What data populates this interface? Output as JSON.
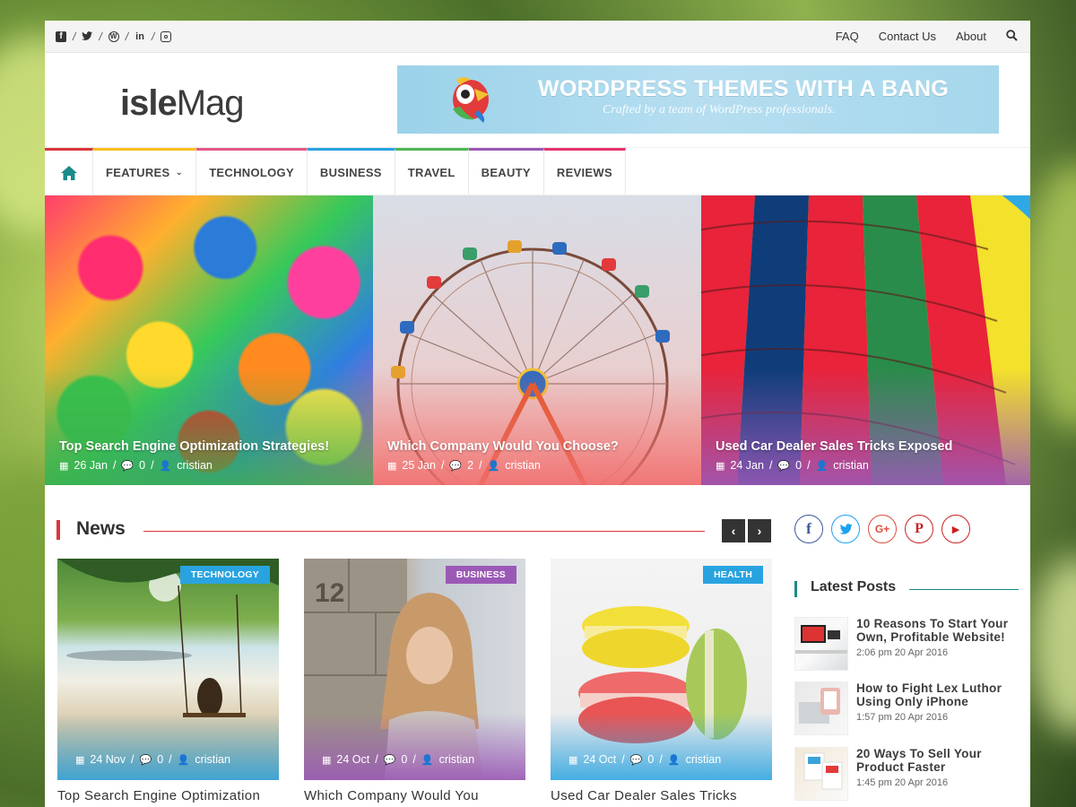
{
  "topbar": {
    "social_icons": [
      "facebook-icon",
      "twitter-icon",
      "wordpress-icon",
      "linkedin-icon",
      "instagram-icon"
    ],
    "links": [
      "FAQ",
      "Contact Us",
      "About"
    ]
  },
  "header": {
    "logo_bold": "isle",
    "logo_light": "Mag",
    "banner_title": "WORDPRESS THEMES WITH A BANG",
    "banner_subtitle": "Crafted by a team of WordPress professionals."
  },
  "nav": {
    "items": [
      {
        "label": "FEATURES",
        "dropdown": true,
        "color": "#f7c01f"
      },
      {
        "label": "TECHNOLOGY",
        "color": "#e35a87"
      },
      {
        "label": "BUSINESS",
        "color": "#29a3e0"
      },
      {
        "label": "TRAVEL",
        "color": "#52b556"
      },
      {
        "label": "BEAUTY",
        "color": "#9b59b6"
      },
      {
        "label": "REVIEWS",
        "color": "#e6336b"
      }
    ],
    "home_accent": "#d9363e"
  },
  "featured": [
    {
      "title": "Top Search Engine Optimization Strategies!",
      "date": "26 Jan",
      "comments": "0",
      "author": "cristian"
    },
    {
      "title": "Which Company Would You Choose?",
      "date": "25 Jan",
      "comments": "2",
      "author": "cristian"
    },
    {
      "title": "Used Car Dealer Sales Tricks Exposed",
      "date": "24 Jan",
      "comments": "0",
      "author": "cristian"
    }
  ],
  "news": {
    "heading": "News",
    "prev": "‹",
    "next": "›",
    "cards": [
      {
        "tag": "TECHNOLOGY",
        "tag_color": "#29a3e0",
        "date": "24 Nov",
        "comments": "0",
        "author": "cristian",
        "title": "Top Search Engine Optimization"
      },
      {
        "tag": "BUSINESS",
        "tag_color": "#9b59b6",
        "date": "24 Oct",
        "comments": "0",
        "author": "cristian",
        "title": "Which Company Would You"
      },
      {
        "tag": "HEALTH",
        "tag_color": "#29a3e0",
        "date": "24 Oct",
        "comments": "0",
        "author": "cristian",
        "title": "Used Car Dealer Sales Tricks"
      }
    ]
  },
  "sidebar": {
    "socials": [
      {
        "name": "facebook",
        "glyph": "f",
        "color": "#3b5998"
      },
      {
        "name": "twitter",
        "glyph": "t",
        "color": "#1da1f2"
      },
      {
        "name": "google-plus",
        "glyph": "G+",
        "color": "#dd4b39"
      },
      {
        "name": "pinterest",
        "glyph": "P",
        "color": "#cb2027"
      },
      {
        "name": "youtube",
        "glyph": "▶",
        "color": "#cd201f"
      }
    ],
    "latest_heading": "Latest Posts",
    "latest": [
      {
        "title": "10 Reasons To Start Your Own, Profitable Website!",
        "date": "2:06 pm 20 Apr 2016"
      },
      {
        "title": "How to Fight Lex Luthor Using Only iPhone",
        "date": "1:57 pm 20 Apr 2016"
      },
      {
        "title": "20 Ways To Sell Your Product Faster",
        "date": "1:45 pm 20 Apr 2016"
      }
    ]
  }
}
